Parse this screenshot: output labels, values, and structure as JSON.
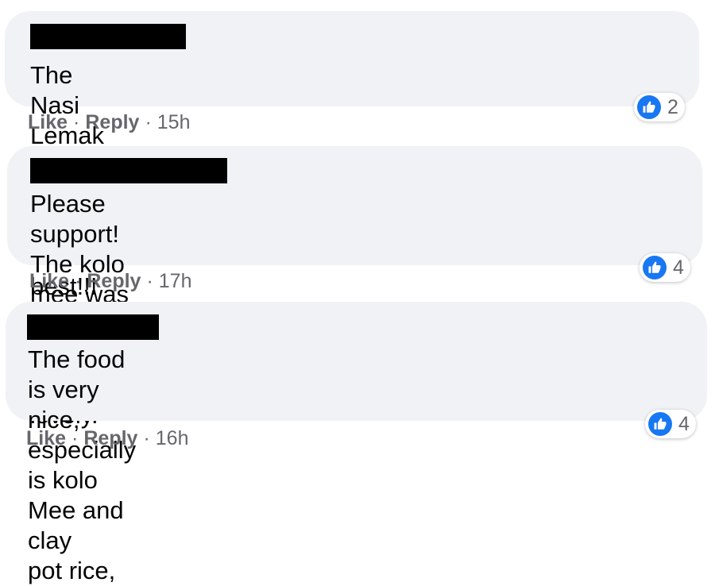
{
  "actions": {
    "like": "Like",
    "reply": "Reply",
    "separator": "·"
  },
  "colors": {
    "bubble": "#f0f2f5",
    "like_blue": "#1877f2",
    "meta_gray": "#65676b",
    "text": "#050505"
  },
  "comments": [
    {
      "author": "[redacted]",
      "text": "The Nasi Lemak with rendang chicken is the best!!!",
      "time": "15h",
      "reaction_icon": "thumbs-up-icon",
      "reaction_count": "2"
    },
    {
      "author": "[redacted]",
      "text": "Please support! The kolo mee was fantastic, muffin\nwas lovely.",
      "time": "17h",
      "reaction_icon": "thumbs-up-icon",
      "reaction_count": "4"
    },
    {
      "author": "[redacted]",
      "text": "The food is very nice, especially is kolo Mee and clay\npot rice,",
      "time": "16h",
      "reaction_icon": "thumbs-up-icon",
      "reaction_count": "4"
    }
  ]
}
